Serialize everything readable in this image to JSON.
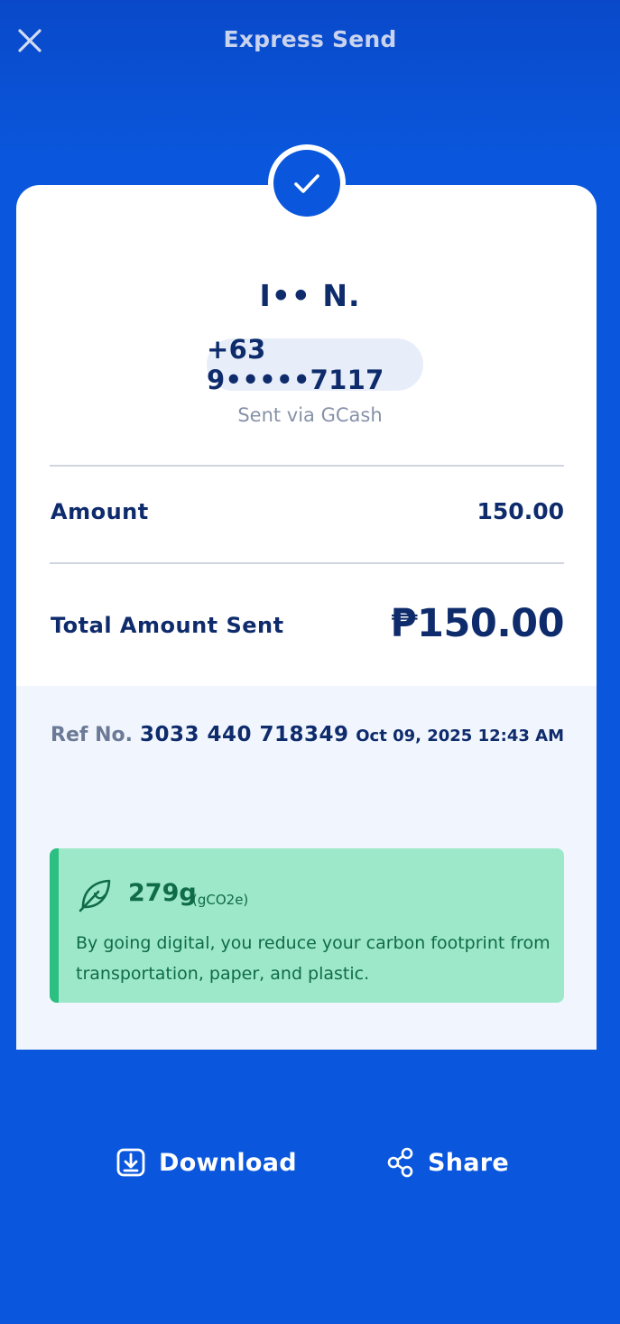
{
  "header": {
    "title": "Express Send",
    "close_icon": "close-icon"
  },
  "receipt": {
    "status_icon": "check-icon",
    "recipient_name": "I•• N.",
    "recipient_phone": "+63 9•••••7117",
    "sent_via": "Sent via GCash",
    "amount_label": "Amount",
    "amount_value": "150.00",
    "total_label": "Total Amount Sent",
    "total_value": "₱150.00",
    "ref_label": "Ref No.",
    "ref_number": "3033 440 718349",
    "date": "Oct 09, 2025 12:43 AM"
  },
  "eco": {
    "icon": "leaf-icon",
    "amount": "279g",
    "unit": "(gCO2e)",
    "message": "By going digital, you reduce your carbon footprint from transportation, paper, and plastic."
  },
  "actions": {
    "download_label": "Download",
    "download_icon": "download-icon",
    "share_label": "Share",
    "share_icon": "share-icon"
  },
  "colors": {
    "background": "#0a57dd",
    "text_primary": "#0e2b6c",
    "eco_background": "#9de8c8",
    "eco_accent": "#2bbf82"
  }
}
